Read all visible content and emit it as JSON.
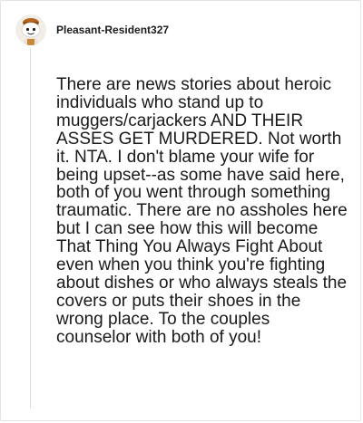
{
  "comment": {
    "author": "Pleasant-Resident327",
    "avatar_icon": "reddit-snoo-avatar-icon",
    "body": "There are news stories about heroic individuals who stand up to muggers/carjackers AND THEIR ASSES GET MURDERED. Not worth it. NTA. I don't blame your wife for being upset--as some have said here, both of you went through something traumatic. There are no assholes here but I can see how this will become That Thing You Always Fight About even when you think you're fighting about dishes or who always steals the covers or puts their shoes in the wrong place. To the couples counselor with both of you!"
  },
  "colors": {
    "text": "#1a1a1a",
    "thread_line": "#dcdcdc",
    "border": "#e4e4e4"
  }
}
